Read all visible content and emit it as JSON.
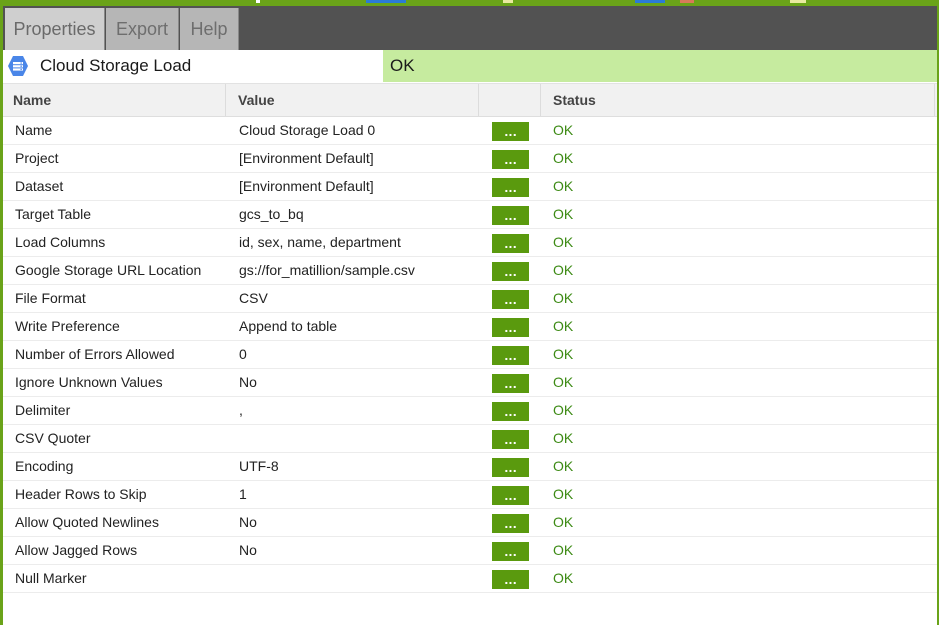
{
  "tabs": [
    {
      "label": "Properties"
    },
    {
      "label": "Export"
    },
    {
      "label": "Help"
    }
  ],
  "component": {
    "icon": "cloud-storage-icon",
    "name": "Cloud Storage Load",
    "status": "OK"
  },
  "grid": {
    "headers": {
      "name": "Name",
      "value": "Value",
      "edit": "",
      "status": "Status"
    },
    "edit_button_label": "...",
    "rows": [
      {
        "name": "Name",
        "value": "Cloud Storage Load 0",
        "status": "OK"
      },
      {
        "name": "Project",
        "value": "[Environment Default]",
        "status": "OK"
      },
      {
        "name": "Dataset",
        "value": "[Environment Default]",
        "status": "OK"
      },
      {
        "name": "Target Table",
        "value": "gcs_to_bq",
        "status": "OK"
      },
      {
        "name": "Load Columns",
        "value": "id, sex, name, department",
        "status": "OK"
      },
      {
        "name": "Google Storage URL Location",
        "value": "gs://for_matillion/sample.csv",
        "status": "OK"
      },
      {
        "name": "File Format",
        "value": "CSV",
        "status": "OK"
      },
      {
        "name": "Write Preference",
        "value": "Append to table",
        "status": "OK"
      },
      {
        "name": "Number of Errors Allowed",
        "value": "0",
        "status": "OK"
      },
      {
        "name": "Ignore Unknown Values",
        "value": "No",
        "status": "OK"
      },
      {
        "name": "Delimiter",
        "value": ",",
        "status": "OK"
      },
      {
        "name": "CSV Quoter",
        "value": "",
        "status": "OK"
      },
      {
        "name": "Encoding",
        "value": "UTF-8",
        "status": "OK"
      },
      {
        "name": "Header Rows to Skip",
        "value": "1",
        "status": "OK"
      },
      {
        "name": "Allow Quoted Newlines",
        "value": "No",
        "status": "OK"
      },
      {
        "name": "Allow Jagged Rows",
        "value": "No",
        "status": "OK"
      },
      {
        "name": "Null Marker",
        "value": "",
        "status": "OK"
      }
    ]
  },
  "colors": {
    "accent": "#6aa319",
    "button": "#5a9a0e",
    "status_ok": "#3c8a14",
    "status_bar": "#c6eb9f",
    "tabbar": "#525252"
  }
}
